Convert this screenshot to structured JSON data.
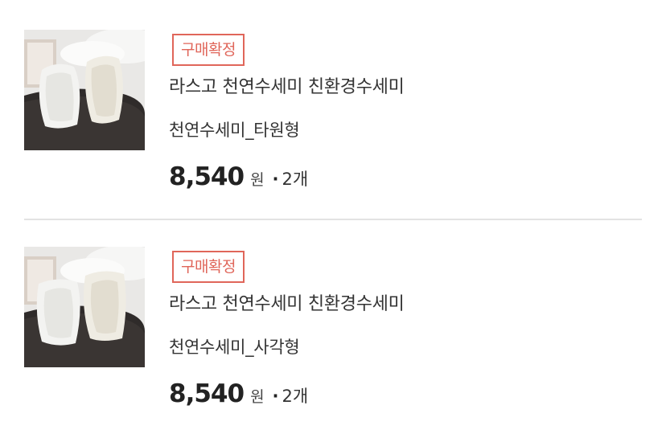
{
  "orders": [
    {
      "status_badge": "구매확정",
      "product_name": "라스고 천연수세미 친환경수세미",
      "option": "천연수세미_타원형",
      "price": "8,540",
      "currency": "원",
      "separator": "·",
      "quantity": "2개",
      "thumbnail_icon": "loofah-sponge-product-image"
    },
    {
      "status_badge": "구매확정",
      "product_name": "라스고 천연수세미 친환경수세미",
      "option": "천연수세미_사각형",
      "price": "8,540",
      "currency": "원",
      "separator": "·",
      "quantity": "2개",
      "thumbnail_icon": "loofah-sponge-product-image"
    }
  ],
  "colors": {
    "badge": "#e0665a",
    "divider": "#e3e3e3",
    "text": "#333333"
  }
}
